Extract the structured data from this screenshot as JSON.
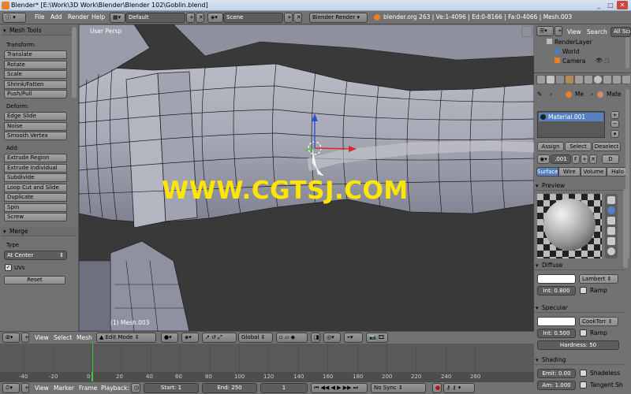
{
  "window": {
    "title": "Blender* [E:\\Work\\3D Work\\Blender\\Blender 102\\Goblin.blend]",
    "controls": [
      "_",
      "□",
      "✕"
    ]
  },
  "info_header": {
    "menus": [
      "File",
      "Add",
      "Render",
      "Help"
    ],
    "layout": "Default",
    "scene": "Scene",
    "engine": "Blender Render",
    "stats": "blender.org 263 | Ve:1-4096 | Ed:0-8166 | Fa:0-4066 | Mesh.003"
  },
  "tool_shelf": {
    "mesh_tools_header": "Mesh Tools",
    "transform_label": "Transform:",
    "transform": [
      "Translate",
      "Rotate",
      "Scale",
      "Shrink/Fatten",
      "Push/Pull"
    ],
    "deform_label": "Deform:",
    "deform": [
      "Edge Slide",
      "Noise",
      "Smooth Vertex"
    ],
    "add_label": "Add:",
    "add": [
      "Extrude Region",
      "Extrude Individual",
      "Subdivide",
      "Loop Cut and Slide",
      "Duplicate",
      "Spin",
      "Screw"
    ],
    "merge_header": "Merge",
    "type_label": "Type",
    "type_value": "At Center",
    "uvs_label": "UVs",
    "reset_label": "Reset"
  },
  "viewport": {
    "view_name": "User Persp",
    "object_info": "(1) Mesh.003",
    "watermark": "WWW.CGTSJ.COM",
    "header": {
      "menus": [
        "View",
        "Select",
        "Mesh"
      ],
      "mode": "Edit Mode",
      "orientation": "Global"
    }
  },
  "timeline": {
    "ticks": [
      "-40",
      "-20",
      "0",
      "20",
      "40",
      "60",
      "80",
      "100",
      "120",
      "140",
      "160",
      "180",
      "200",
      "220",
      "240",
      "260"
    ],
    "current_frame_tick": "0",
    "header": {
      "menus": [
        "View",
        "Marker",
        "Frame",
        "Playback:"
      ],
      "start": "Start: 1",
      "end": "End: 250",
      "current": "1",
      "sync": "No Sync"
    }
  },
  "outliner": {
    "menus": [
      "View",
      "Search"
    ],
    "all_scenes": "All Scenes",
    "items": [
      "RenderLayer",
      "World",
      "Camera"
    ]
  },
  "properties": {
    "breadcrumb_me": "Me",
    "breadcrumb_mat": "Mate",
    "material_name": "Material.001",
    "assign": "Assign",
    "select": "Select",
    "deselect": "Deselect",
    "slot_name": ".001",
    "slot_f": "F",
    "slot_d": "D",
    "tabs": [
      "Surface",
      "Wire",
      "Volume",
      "Halo"
    ],
    "preview_header": "Preview",
    "diffuse_header": "Diffuse",
    "diffuse_shader": "Lambert",
    "diffuse_intensity": "Int: 0.800",
    "ramp_label": "Ramp",
    "specular_header": "Specular",
    "specular_shader": "CookTorr",
    "specular_intensity": "Int: 0.500",
    "specular_ramp": "Ramp",
    "hardness": "Hardness: 50",
    "shading_header": "Shading",
    "emit": "Emit: 0.00",
    "shadeless": "Shadeless",
    "ambient": "Am: 1.000",
    "tangent": "Tangent Sh"
  },
  "colors": {
    "accent_blue": "#5680c2",
    "frame_line": "#3dcc3d",
    "watermark_yellow": "#ffe600",
    "mesh_face": "#a9abb7"
  }
}
